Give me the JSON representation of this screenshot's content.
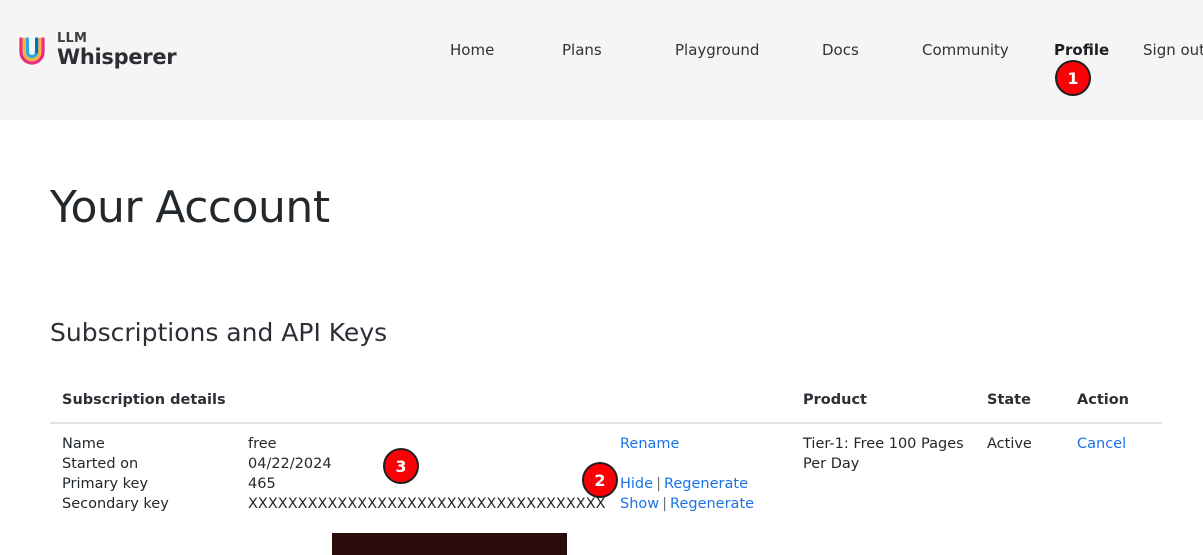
{
  "brand": {
    "line1": "LLM",
    "line2": "Whisperer",
    "mark_icon": "llm-whisperer-u-logo",
    "colors": {
      "pink": "#ec2a7b",
      "yellow": "#fbb03b",
      "cyan": "#29abe2",
      "blue": "#0071bc"
    }
  },
  "nav": {
    "items": [
      {
        "label": "Home",
        "active": false
      },
      {
        "label": "Plans",
        "active": false
      },
      {
        "label": "Playground",
        "active": false
      },
      {
        "label": "Docs",
        "active": false
      },
      {
        "label": "Community",
        "active": false
      },
      {
        "label": "Profile",
        "active": true
      },
      {
        "label": "Sign out",
        "active": false
      }
    ]
  },
  "badges": {
    "one": "1",
    "two": "2",
    "three": "3",
    "color": "#fb0007"
  },
  "page": {
    "title": "Your Account",
    "section_title": "Subscriptions and API Keys"
  },
  "table": {
    "headers": {
      "details": "Subscription details",
      "product": "Product",
      "state": "State",
      "action": "Action"
    },
    "row": {
      "details": [
        {
          "label": "Name",
          "value": "free",
          "links": []
        },
        {
          "label": "Started on",
          "value": "04/22/2024",
          "links": []
        },
        {
          "label": "Primary key",
          "value": "465",
          "links": [
            "Hide",
            "Regenerate"
          ]
        },
        {
          "label": "Secondary key",
          "value": "XXXXXXXXXXXXXXXXXXXXXXXXXXXXXXXXXXXX",
          "links": [
            "Show",
            "Regenerate"
          ]
        }
      ],
      "rename_link": "Rename",
      "link_separator": "|",
      "product": "Tier-1: Free 100 Pages Per Day",
      "state": "Active",
      "action": "Cancel"
    }
  }
}
